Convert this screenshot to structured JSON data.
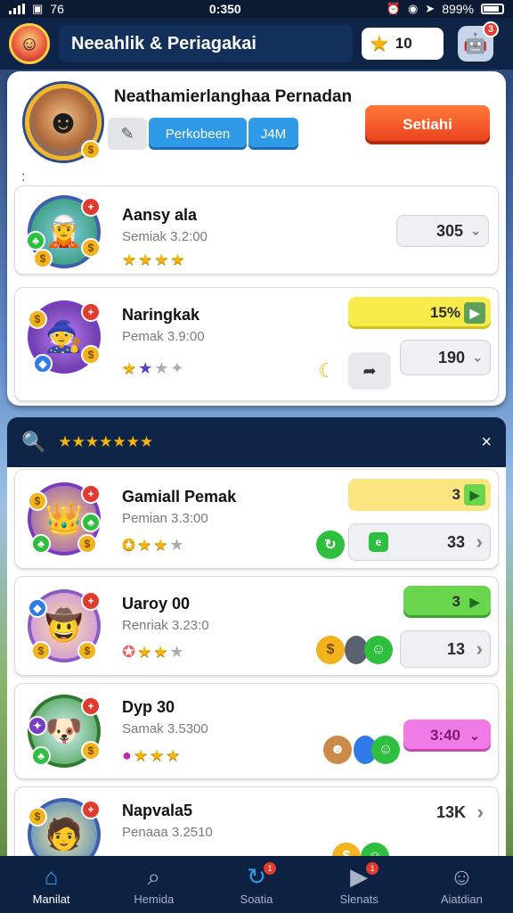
{
  "status_bar": {
    "carrier": "76",
    "time": "0:350",
    "battery": "899%"
  },
  "header": {
    "title": "Neeahlik & Periagakai",
    "score": "10",
    "robot_badge": "3"
  },
  "profile": {
    "name": "Neathamierlanghaa Pernadan",
    "segment_buttons": [
      "Perkobeen",
      "J4M"
    ],
    "primary_button": "Setiahi",
    "menu_glyph": ":"
  },
  "top_rows": [
    {
      "title": "Aansy ala",
      "subtitle": "Semiak 3.2:00",
      "value": "305",
      "status": ""
    },
    {
      "title": "Naringkak",
      "subtitle": "Pemak 3.9:00",
      "status": "15%",
      "value": "190"
    }
  ],
  "section": {
    "stars": "★★★★★★★",
    "close": "×"
  },
  "list_rows": [
    {
      "title": "Gamiall Pemak",
      "subtitle": "Pemian 3.3:00",
      "status": "3",
      "value": "33"
    },
    {
      "title": "Uaroy 00",
      "subtitle": "Renriak 3.23:0",
      "status": "3",
      "value": "13"
    },
    {
      "title": "Dyp 30",
      "subtitle": "Samak 3.5300",
      "status": "3:40"
    },
    {
      "title": "Napvala5",
      "subtitle": "Penaaa 3.2510",
      "value": "13K"
    }
  ],
  "bottom_nav": [
    {
      "label": "Manilat",
      "icon": "home-icon",
      "active": true
    },
    {
      "label": "Hemida",
      "icon": "search-icon"
    },
    {
      "label": "Soatia",
      "icon": "sync-icon",
      "badge": "1"
    },
    {
      "label": "Slenats",
      "icon": "play-icon",
      "badge": "1"
    },
    {
      "label": "Aiatdian",
      "icon": "profile-icon"
    }
  ],
  "colors": {
    "header_bg": "#0f2547",
    "primary_orange": "#ea3e1d",
    "accent_blue": "#2f9be8",
    "star_gold": "#f6b40f"
  }
}
